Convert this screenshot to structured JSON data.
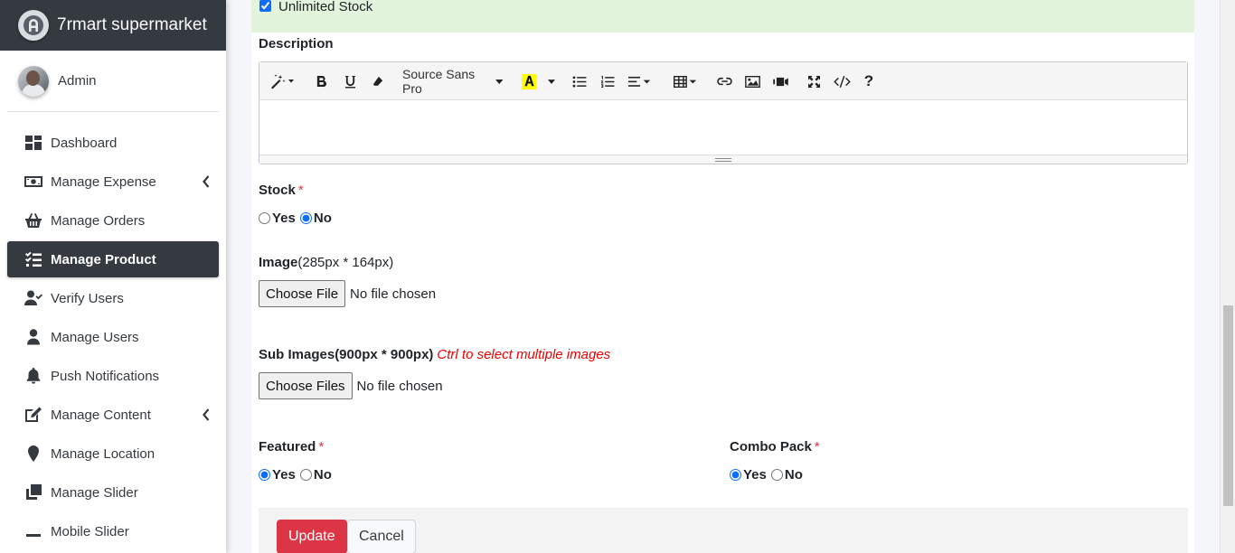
{
  "brand": {
    "title": "7rmart supermarket"
  },
  "user": {
    "name": "Admin"
  },
  "sidebar": {
    "items": [
      {
        "label": "Dashboard",
        "icon": "dashboard-icon"
      },
      {
        "label": "Manage Expense",
        "icon": "money-icon",
        "expandable": true
      },
      {
        "label": "Manage Orders",
        "icon": "basket-icon"
      },
      {
        "label": "Manage Product",
        "icon": "tasks-icon",
        "active": true
      },
      {
        "label": "Verify Users",
        "icon": "user-check-icon"
      },
      {
        "label": "Manage Users",
        "icon": "user-icon"
      },
      {
        "label": "Push Notifications",
        "icon": "bell-icon"
      },
      {
        "label": "Manage Content",
        "icon": "edit-icon",
        "expandable": true
      },
      {
        "label": "Manage Location",
        "icon": "map-marker-icon"
      },
      {
        "label": "Manage Slider",
        "icon": "clone-icon"
      },
      {
        "label": "Mobile Slider",
        "icon": "minus-icon"
      }
    ]
  },
  "form": {
    "unlimited_stock": {
      "label": "Unlimited Stock",
      "checked": true
    },
    "description": {
      "label": "Description",
      "toolbar": {
        "font": "Source Sans Pro",
        "help": "?"
      }
    },
    "stock": {
      "label": "Stock",
      "required_mark": "*",
      "options": [
        "Yes",
        "No"
      ],
      "selected": "No"
    },
    "image": {
      "label": "Image",
      "hint": "(285px * 164px)",
      "button": "Choose File",
      "status": "No file chosen"
    },
    "sub_images": {
      "label": "Sub Images(900px * 900px)",
      "hint": "Ctrl to select multiple images",
      "button": "Choose Files",
      "status": "No file chosen"
    },
    "featured": {
      "label": "Featured",
      "required_mark": "*",
      "options": [
        "Yes",
        "No"
      ],
      "selected": "Yes"
    },
    "combo_pack": {
      "label": "Combo Pack",
      "required_mark": "*",
      "options": [
        "Yes",
        "No"
      ],
      "selected": "Yes"
    },
    "actions": {
      "update": "Update",
      "cancel": "Cancel"
    }
  },
  "colors": {
    "sidebar_dark": "#343a40",
    "success_bg": "#e2f4dc",
    "danger": "#dc3545",
    "hint_red": "#ee0000"
  }
}
